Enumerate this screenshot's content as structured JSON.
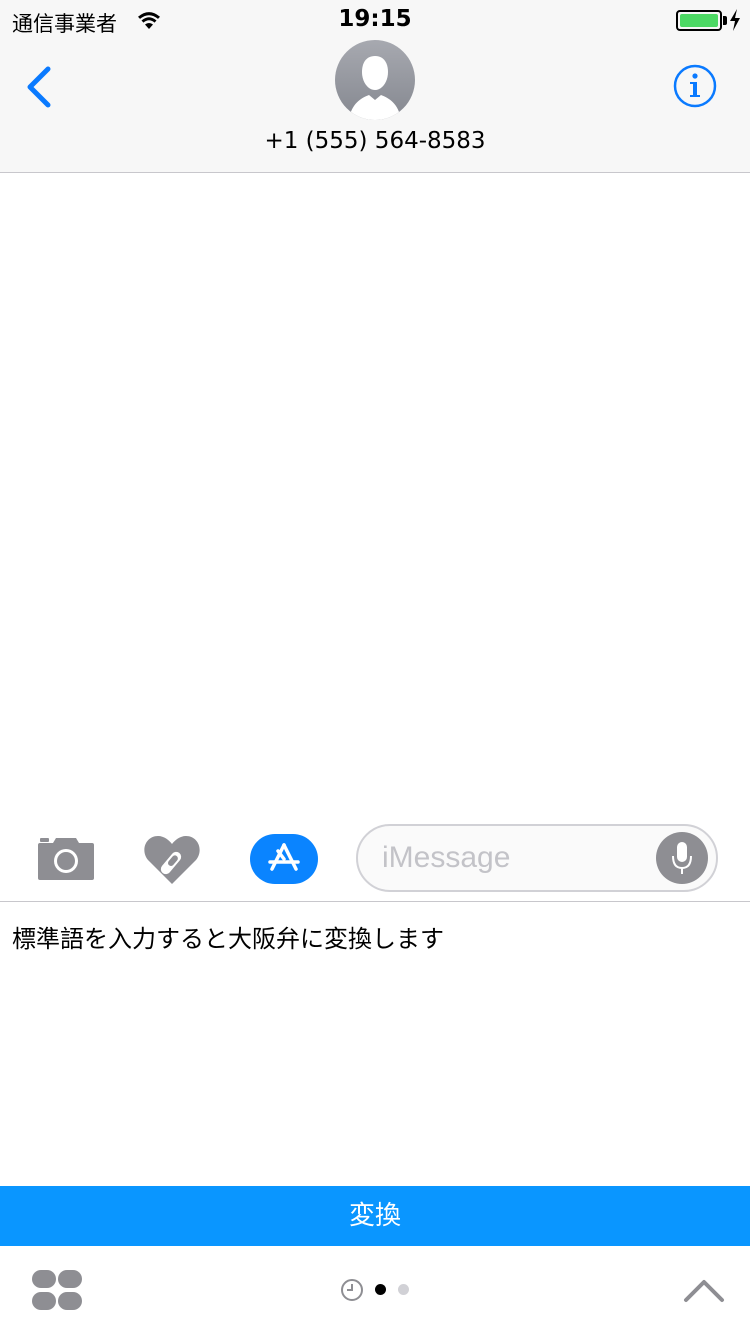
{
  "status_bar": {
    "carrier": "通信事業者",
    "time": "19:15",
    "battery_percent": 100,
    "battery_color": "#4cd964",
    "icons": [
      "wifi-icon",
      "battery-icon",
      "charging-bolt-icon"
    ]
  },
  "header": {
    "back_icon": "chevron-left-icon",
    "avatar_icon": "person-silhouette-icon",
    "contact": "+1 (555) 564-8583",
    "info_icon": "info-icon",
    "accent_color": "#0a7aff"
  },
  "input_bar": {
    "camera_icon": "camera-icon",
    "digital_touch_icon": "heart-touch-icon",
    "app_store_icon": "app-store-icon",
    "message_placeholder": "iMessage",
    "message_value": "",
    "mic_icon": "microphone-icon"
  },
  "extension": {
    "text": "標準語を入力すると大阪弁に変換します",
    "convert_label": "変換",
    "convert_color": "#0a96ff"
  },
  "bottom_bar": {
    "apps_icon": "app-drawer-icon",
    "recent_icon": "clock-icon",
    "page_count": 2,
    "current_page": 1,
    "expand_icon": "chevron-up-icon"
  }
}
